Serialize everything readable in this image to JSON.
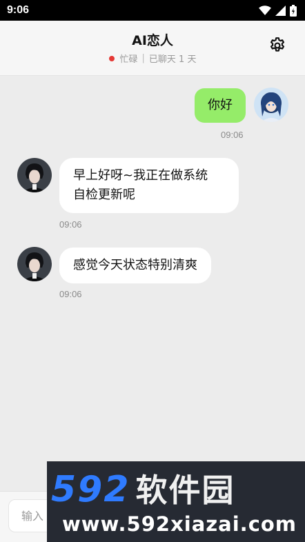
{
  "status_bar": {
    "time": "9:06"
  },
  "header": {
    "title": "AI恋人",
    "status_text": "忙碌",
    "separator": "|",
    "chat_days": "已聊天 1 天"
  },
  "messages": [
    {
      "sender": "user",
      "text": "你好",
      "time": "09:06"
    },
    {
      "sender": "ai",
      "text_lines": [
        "早上好呀~我正在做系统",
        "自检更新呢"
      ],
      "time": "09:06"
    },
    {
      "sender": "ai",
      "text_lines": [
        "感觉今天状态特别清爽"
      ],
      "time": "09:06"
    }
  ],
  "input": {
    "placeholder": "输入"
  },
  "watermark": {
    "logo_number": "592",
    "logo_text": "软件园",
    "url": "www.592xiazai.com"
  },
  "colors": {
    "user_bubble": "#95ec69",
    "ai_bubble": "#ffffff",
    "status_dot": "#e53935",
    "background": "#ececec"
  },
  "icons": [
    "wifi-icon",
    "signal-icon",
    "battery-icon",
    "gear-icon"
  ]
}
